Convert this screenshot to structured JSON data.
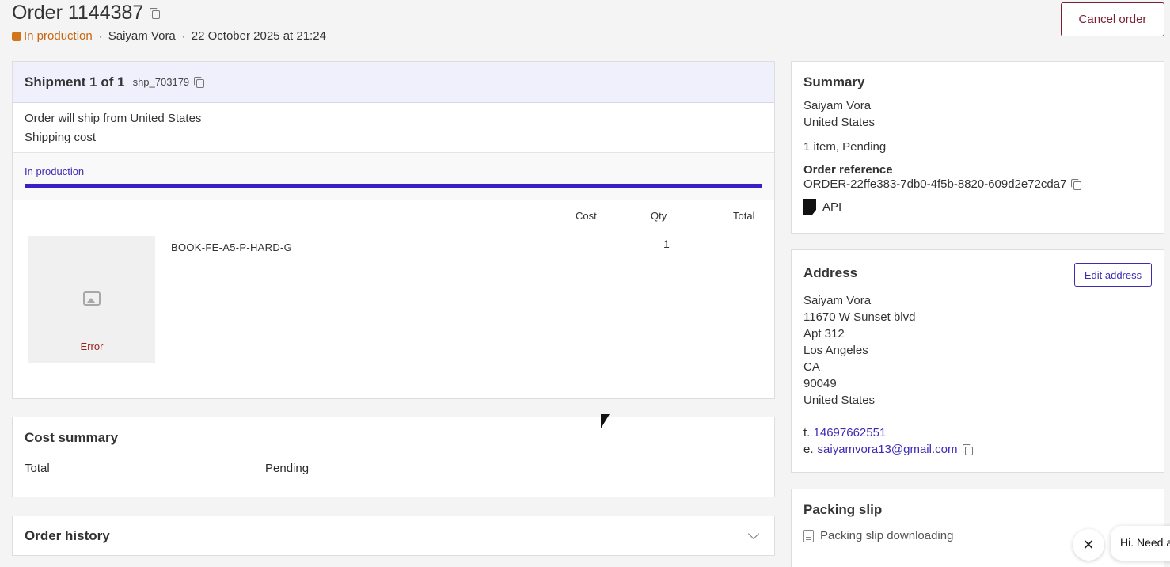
{
  "header": {
    "order_title": "Order 1144387",
    "status": "In production",
    "customer": "Saiyam Vora",
    "date": "22 October 2025 at 21:24",
    "cancel_label": "Cancel order",
    "separator": "·"
  },
  "shipment": {
    "title": "Shipment 1 of 1",
    "id": "shp_703179",
    "ship_from": "Order will ship from United States",
    "shipping_cost_label": "Shipping cost",
    "progress_label": "In production",
    "columns": {
      "cost": "Cost",
      "qty": "Qty",
      "total": "Total"
    },
    "item": {
      "image_error": "Error",
      "sku": "BOOK-FE-A5-P-HARD-G",
      "qty": "1"
    }
  },
  "cost_summary": {
    "title": "Cost summary",
    "total_label": "Total",
    "total_value": "Pending"
  },
  "order_history": {
    "title": "Order history"
  },
  "summary": {
    "title": "Summary",
    "name": "Saiyam Vora",
    "country": "United States",
    "items_status": "1 item, Pending",
    "ref_label": "Order reference",
    "ref_value": "ORDER-22ffe383-7db0-4f5b-8820-609d2e72cda7",
    "source": "API"
  },
  "address": {
    "title": "Address",
    "edit_label": "Edit address",
    "lines": [
      "Saiyam Vora",
      "11670 W Sunset blvd",
      "Apt 312",
      "Los Angeles",
      "CA",
      "90049",
      "United States"
    ],
    "phone_prefix": "t.",
    "phone": "14697662551",
    "email_prefix": "e.",
    "email": "saiyamvora13@gmail.com"
  },
  "packing_slip": {
    "title": "Packing slip",
    "status": "Packing slip downloading"
  },
  "chat": {
    "close": "✕",
    "message": "Hi. Need a"
  },
  "colors": {
    "status": "#d2741a",
    "accent": "#3a1ec8",
    "danger": "#7a1f33"
  }
}
